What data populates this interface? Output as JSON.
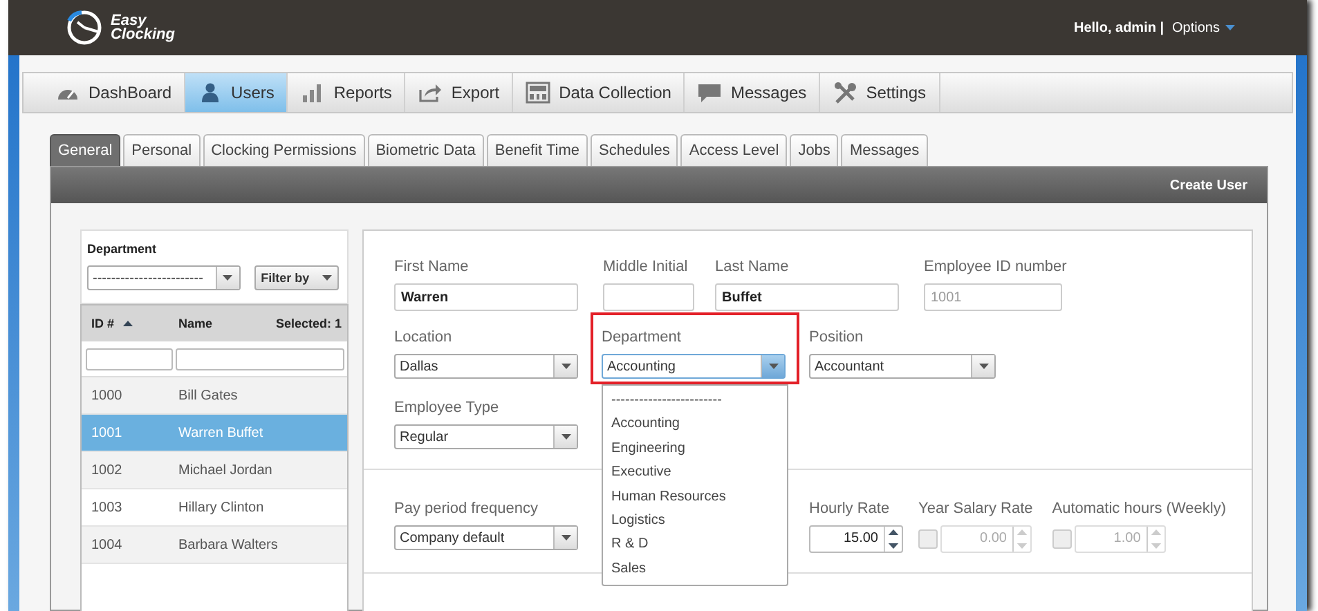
{
  "header": {
    "logo_top": "Easy",
    "logo_bottom": "Clocking",
    "greeting": "Hello, admin |",
    "options": "Options"
  },
  "nav": [
    {
      "label": "DashBoard",
      "selected": false
    },
    {
      "label": "Users",
      "selected": true
    },
    {
      "label": "Reports",
      "selected": false
    },
    {
      "label": "Export",
      "selected": false
    },
    {
      "label": "Data Collection",
      "selected": false
    },
    {
      "label": "Messages",
      "selected": false
    },
    {
      "label": "Settings",
      "selected": false
    }
  ],
  "tabs": [
    {
      "label": "General",
      "selected": true
    },
    {
      "label": "Personal",
      "selected": false
    },
    {
      "label": "Clocking Permissions",
      "selected": false
    },
    {
      "label": "Biometric Data",
      "selected": false
    },
    {
      "label": "Benefit Time",
      "selected": false
    },
    {
      "label": "Schedules",
      "selected": false
    },
    {
      "label": "Access Level",
      "selected": false
    },
    {
      "label": "Jobs",
      "selected": false
    },
    {
      "label": "Messages",
      "selected": false
    }
  ],
  "toolbar": {
    "action": "Create User"
  },
  "filter": {
    "label": "Department",
    "value": "------------------------",
    "button": "Filter by"
  },
  "table": {
    "columns": [
      {
        "label": "ID #",
        "sorted": true
      },
      {
        "label": "Name",
        "sorted": false
      }
    ],
    "selected_count": "Selected: 1",
    "rows": [
      {
        "id": "1000",
        "name": "Bill Gates",
        "selected": false
      },
      {
        "id": "1001",
        "name": "Warren Buffet",
        "selected": true
      },
      {
        "id": "1002",
        "name": "Michael Jordan",
        "selected": false
      },
      {
        "id": "1003",
        "name": "Hillary Clinton",
        "selected": false
      },
      {
        "id": "1004",
        "name": "Barbara Walters",
        "selected": false
      }
    ]
  },
  "form": {
    "rows": [
      [
        {
          "kind": "text",
          "label": "First Name",
          "value": "Warren"
        },
        {
          "kind": "text",
          "label": "Middle Initial"
        },
        {
          "kind": "text",
          "label": "Last Name",
          "value": "Buffet"
        },
        {
          "kind": "text",
          "label": "Employee ID number",
          "value": "1001",
          "disabled": true
        }
      ],
      [
        {
          "kind": "select",
          "label": "Location",
          "value": "Dallas",
          "open": false
        },
        {
          "kind": "select",
          "label": "Department",
          "value": "Accounting",
          "highlighted": true,
          "open": true,
          "options": [
            "------------------------",
            "Accounting",
            "Engineering",
            "Executive",
            "Human Resources",
            "Logistics",
            "R & D",
            "Sales"
          ]
        },
        {
          "kind": "select",
          "label": "Position",
          "value": "Accountant",
          "open": false
        }
      ],
      [
        {
          "kind": "select",
          "label": "Employee Type",
          "value": "Regular",
          "open": false
        }
      ],
      [
        {
          "kind": "select",
          "label": "Pay period frequency",
          "value": "Company default",
          "open": false
        },
        "",
        {
          "kind": "spin",
          "label": "Hourly Rate",
          "value": "15.00",
          "disabled": false
        },
        {
          "kind": "checkspin",
          "label": "Year Salary Rate",
          "checked": false,
          "value": "0.00",
          "disabled": true
        },
        {
          "kind": "checkspin",
          "label": "Automatic hours (Weekly)",
          "checked": false,
          "value": "1.00",
          "disabled": true
        }
      ]
    ]
  }
}
